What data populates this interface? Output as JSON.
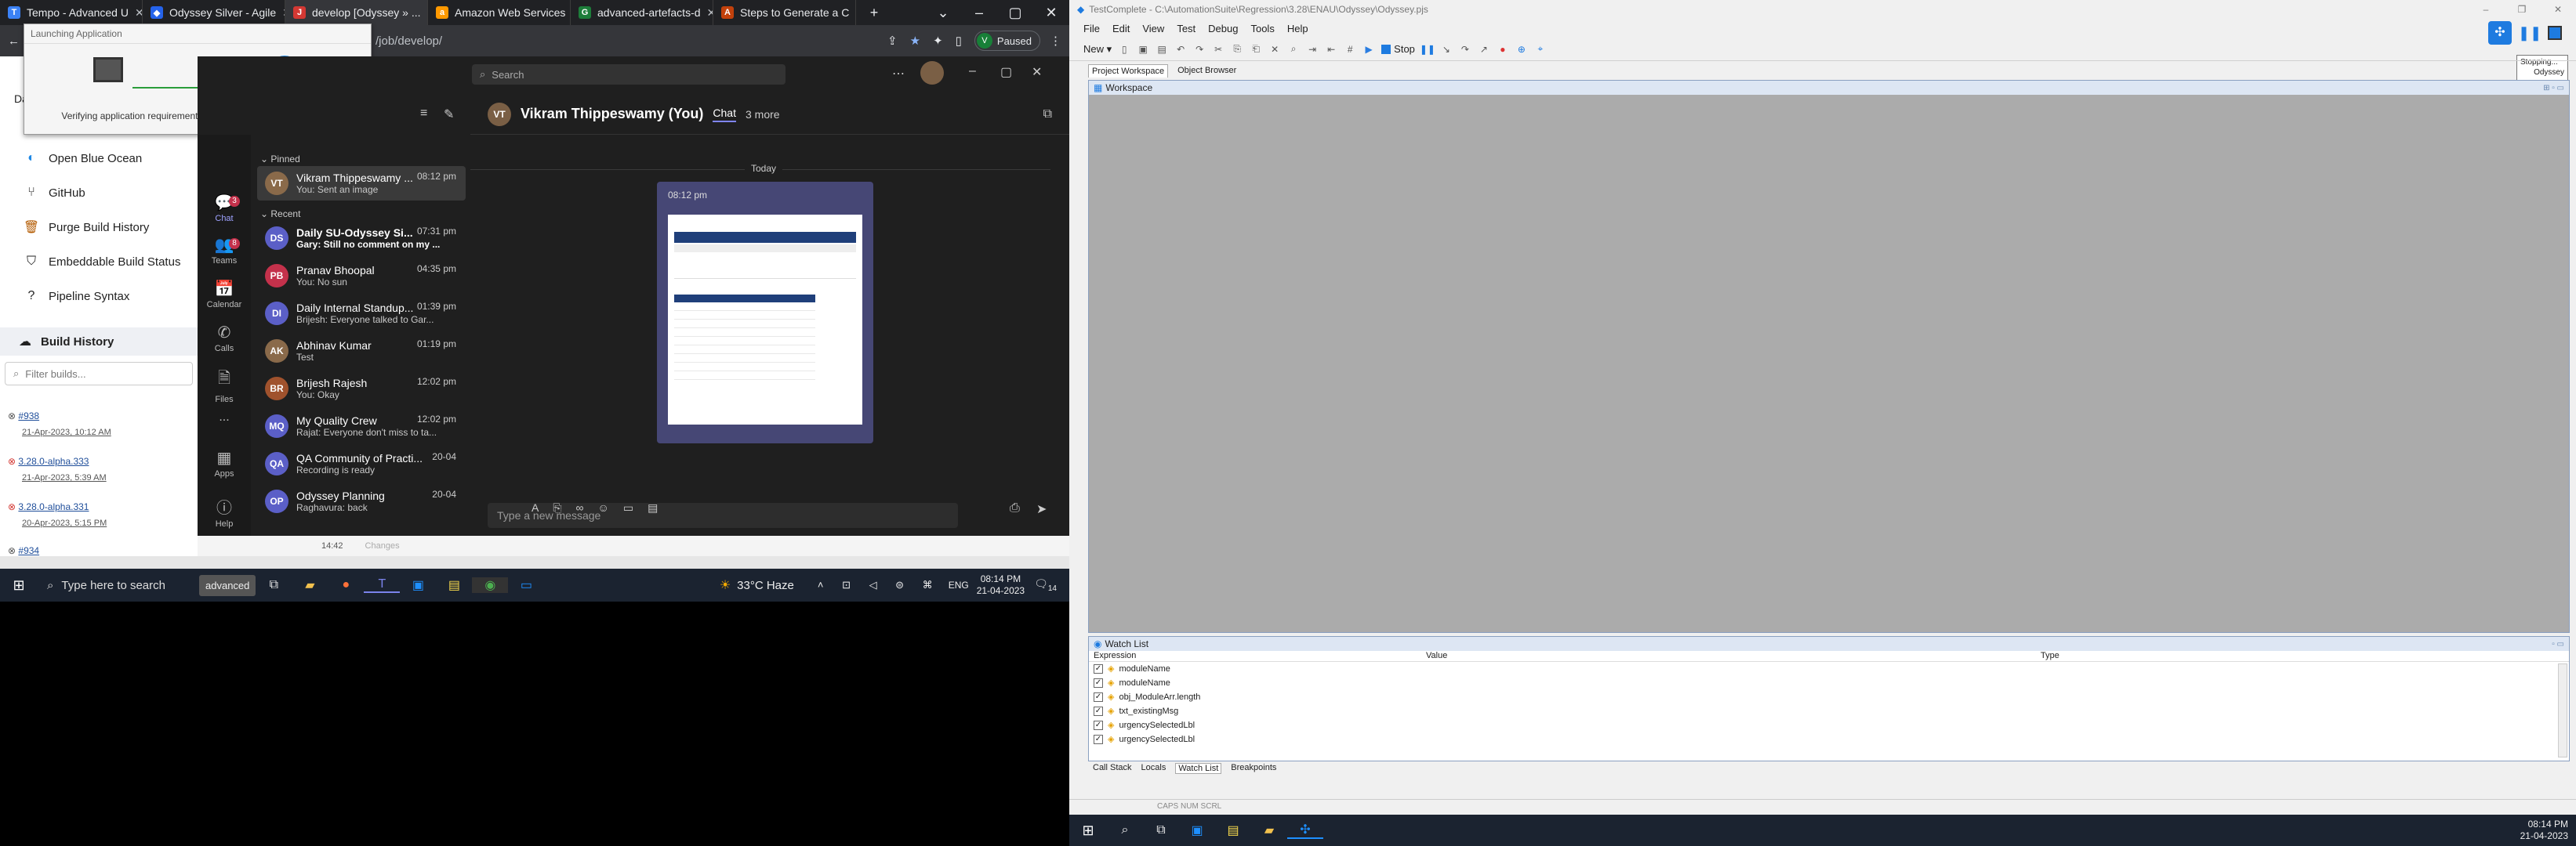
{
  "browser": {
    "tabs": [
      {
        "title": "Tempo - Advanced U",
        "icon_color": "#3b82f6"
      },
      {
        "title": "Odyssey Silver - Agile",
        "icon_color": "#2563eb"
      },
      {
        "title": "develop [Odyssey » ...",
        "icon_color": "#d33833"
      },
      {
        "title": "Amazon Web Services",
        "icon_color": "#ff9900"
      },
      {
        "title": "advanced-artefacts-d",
        "icon_color": "#1d7d3a"
      },
      {
        "title": "Steps to Generate a C",
        "icon_color": "#c2410c"
      }
    ],
    "url": "/job/develop/",
    "paused_label": "Paused"
  },
  "launching_popup": {
    "title": "Launching Application",
    "message": "Verifying application requirements. This may take a few moments."
  },
  "jenkins": {
    "partial_label": "Da",
    "menu": [
      {
        "label": "Open Blue Ocean",
        "icon": "blue-ocean-icon"
      },
      {
        "label": "GitHub",
        "icon": "branch-icon"
      },
      {
        "label": "Purge Build History",
        "icon": "trash-icon"
      },
      {
        "label": "Embeddable Build Status",
        "icon": "shield-icon"
      },
      {
        "label": "Pipeline Syntax",
        "icon": "help-icon"
      }
    ],
    "build_history_label": "Build History",
    "filter_placeholder": "Filter builds...",
    "builds": [
      {
        "name": "#938",
        "date": "21-Apr-2023, 10:12 AM"
      },
      {
        "name": "3.28.0-alpha.333",
        "date": "21-Apr-2023, 5:39 AM"
      },
      {
        "name": "3.28.0-alpha.331",
        "date": "20-Apr-2023, 5:15 PM"
      },
      {
        "name": "#934",
        "date": ""
      }
    ],
    "footer_time": "14:42",
    "footer_changes": "Changes"
  },
  "teams": {
    "search_placeholder": "Search",
    "rail": [
      {
        "label": "Chat",
        "badge": "3"
      },
      {
        "label": "Teams",
        "badge": "8"
      },
      {
        "label": "Calendar",
        "badge": ""
      },
      {
        "label": "Calls",
        "badge": ""
      },
      {
        "label": "Files",
        "badge": ""
      },
      {
        "label": "...",
        "badge": ""
      },
      {
        "label": "Apps",
        "badge": ""
      },
      {
        "label": "Help",
        "badge": ""
      }
    ],
    "pinned_label": "Pinned",
    "recent_label": "Recent",
    "pinned": [
      {
        "name": "Vikram Thippeswamy ...",
        "preview": "You: Sent an image",
        "time": "08:12 pm",
        "initials": "VT",
        "color": "#8a6a4a"
      }
    ],
    "chats": [
      {
        "name": "Daily SU-Odyssey Si...",
        "preview": "Gary: Still no comment on my ...",
        "time": "07:31 pm",
        "initials": "DS",
        "color": "#5b5fc7",
        "bold": true
      },
      {
        "name": "Pranav Bhoopal",
        "preview": "You: No sun",
        "time": "04:35 pm",
        "initials": "PB",
        "color": "#c4314b"
      },
      {
        "name": "Daily Internal Standup...",
        "preview": "Brijesh: Everyone talked to Gar...",
        "time": "01:39 pm",
        "initials": "DI",
        "color": "#5b5fc7"
      },
      {
        "name": "Abhinav Kumar",
        "preview": "Test",
        "time": "01:19 pm",
        "initials": "AK",
        "color": "#8a6a4a"
      },
      {
        "name": "Brijesh Rajesh",
        "preview": "You: Okay",
        "time": "12:02 pm",
        "initials": "BR",
        "color": "#a0522d"
      },
      {
        "name": "My Quality Crew",
        "preview": "Rajat: Everyone don't miss to ta...",
        "time": "12:02 pm",
        "initials": "MQ",
        "color": "#5b5fc7"
      },
      {
        "name": "QA Community of Practi...",
        "preview": "Recording is ready",
        "time": "20-04",
        "initials": "QA",
        "color": "#5b5fc7"
      },
      {
        "name": "Odyssey Planning",
        "preview": "Raghavura: back",
        "time": "20-04",
        "initials": "OP",
        "color": "#5b5fc7"
      }
    ],
    "chat_header": {
      "name": "Vikram Thippeswamy (You)",
      "tab_chat": "Chat",
      "tab_more": "3 more"
    },
    "day_separator": "Today",
    "message_time": "08:12 pm",
    "compose_placeholder": "Type a new message"
  },
  "taskbar_left": {
    "search_placeholder": "Type here to search",
    "weather": "33°C  Haze",
    "lang": "ENG",
    "time": "08:14 PM",
    "date": "21-04-2023",
    "notif": "14",
    "advanced_label": "advanced"
  },
  "testcomplete": {
    "title": "TestComplete - C:\\AutomationSuite\\Regression\\3.28\\ENAU\\Odyssey\\Odyssey.pjs",
    "menu": [
      "File",
      "Edit",
      "View",
      "Test",
      "Debug",
      "Tools",
      "Help"
    ],
    "toolbar": {
      "new_label": "New",
      "stop_label": "Stop"
    },
    "panel_tabs": [
      "Project Workspace",
      "Object Browser"
    ],
    "workspace_label": "Workspace",
    "tooltip_lines": [
      "Stopping...",
      "Odyssey"
    ],
    "watch": {
      "title": "Watch List",
      "columns": [
        "Expression",
        "Value",
        "Type"
      ],
      "rows": [
        "moduleName",
        "moduleName",
        "obj_ModuleArr.length",
        "txt_existingMsg",
        "urgencySelectedLbl",
        "urgencySelectedLbl"
      ]
    },
    "bottom_tabs": [
      "Call Stack",
      "Locals",
      "Watch List",
      "Breakpoints"
    ],
    "status": "CAPS  NUM  SCRL"
  },
  "taskbar_right": {
    "time": "08:14 PM",
    "date": "21-04-2023"
  }
}
